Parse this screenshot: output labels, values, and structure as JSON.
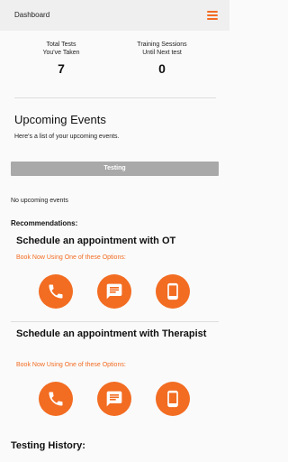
{
  "appbar": {
    "title": "Dashboard"
  },
  "stats": [
    {
      "label": "Total Tests\nYou've Taken",
      "value": "7"
    },
    {
      "label": "Training Sessions\nUntil Next test",
      "value": "0"
    }
  ],
  "events": {
    "title": "Upcoming Events",
    "subtitle": "Here's a list of your upcoming events.",
    "tab_label": "Testing",
    "empty_text": "No upcoming events"
  },
  "recommendations": {
    "heading": "Recommendations:",
    "cards": [
      {
        "title": "Schedule an appointment with OT",
        "subtitle": "Book Now Using One of these Options:"
      },
      {
        "title": "Schedule an appointment with Therapist",
        "subtitle": "Book Now Using One of these Options:"
      }
    ],
    "options": [
      "phone-icon",
      "message-icon",
      "mobile-icon"
    ]
  },
  "history": {
    "title": "Testing History:"
  },
  "colors": {
    "accent": "#f26c22",
    "tab": "#a9a9a9"
  }
}
